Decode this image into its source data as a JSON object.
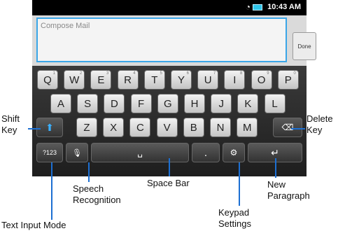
{
  "status": {
    "time": "10:43 AM"
  },
  "compose": {
    "placeholder": "Compose Mail",
    "done_label": "Done"
  },
  "keyboard": {
    "row1": [
      {
        "label": "Q",
        "num": "1"
      },
      {
        "label": "W",
        "num": "2"
      },
      {
        "label": "E",
        "num": "3"
      },
      {
        "label": "R",
        "num": "4"
      },
      {
        "label": "T",
        "num": "5"
      },
      {
        "label": "Y",
        "num": "6"
      },
      {
        "label": "U",
        "num": "7"
      },
      {
        "label": "I",
        "num": "8"
      },
      {
        "label": "O",
        "num": "9"
      },
      {
        "label": "P",
        "num": "0"
      }
    ],
    "row2": [
      "A",
      "S",
      "D",
      "F",
      "G",
      "H",
      "J",
      "K",
      "L"
    ],
    "row3": [
      "Z",
      "X",
      "C",
      "V",
      "B",
      "N",
      "M"
    ],
    "mode_label": "?123",
    "period_label": "."
  },
  "annotations": {
    "shift_key": "Shift\nKey",
    "delete_key": "Delete\nKey",
    "speech": "Speech\nRecognition",
    "space_bar": "Space Bar",
    "new_paragraph": "New\nParagraph",
    "keypad_settings": "Keypad\nSettings",
    "text_input_mode": "Text Input Mode"
  }
}
